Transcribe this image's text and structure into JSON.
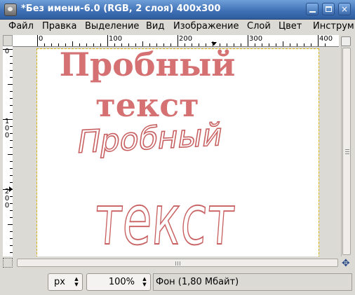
{
  "window": {
    "title": "*Без имени-6.0 (RGB, 2 слоя) 400x300",
    "buttons": {
      "minimize": "minimize",
      "maximize": "maximize",
      "close": "×"
    }
  },
  "menu": {
    "items": [
      "Файл",
      "Правка",
      "Выделение",
      "Вид",
      "Изображение",
      "Слой",
      "Цвет",
      "Инструм"
    ]
  },
  "rulers": {
    "horizontal_labels": [
      "0",
      "100",
      "200",
      "300",
      "400"
    ],
    "vertical_labels": [
      "0",
      "100",
      "200"
    ]
  },
  "canvas": {
    "text_line1": "Пробный",
    "text_line2": "текст",
    "outline_line1": "Пробный",
    "outline_line2": "текст",
    "text_color": "#d57172",
    "outline_color": "#c85f60"
  },
  "statusbar": {
    "units": "px",
    "zoom": "100%",
    "layer_info": "Фон (1,80 Мбайт)"
  },
  "icons": {
    "app": "gimp-icon",
    "navigate": "navigate-icon",
    "quick_mask": "quick-mask-icon",
    "move": "move-icon"
  }
}
